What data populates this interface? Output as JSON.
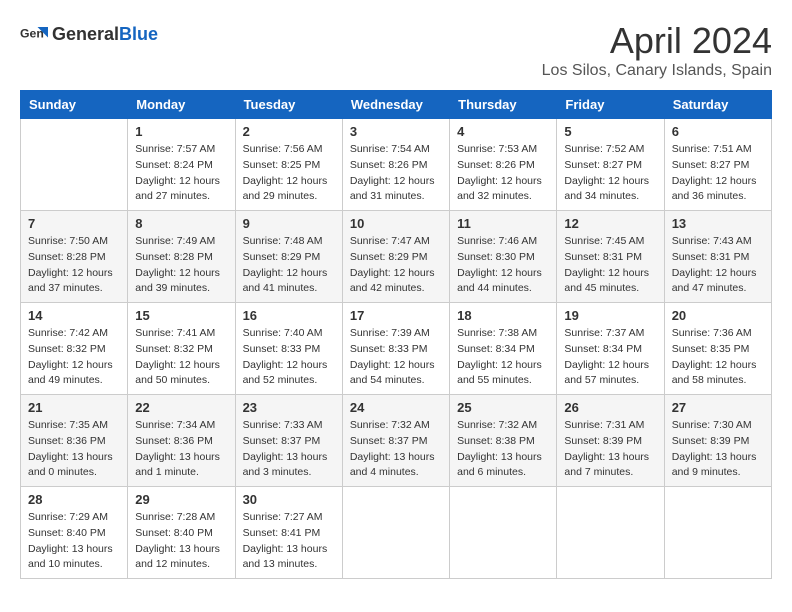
{
  "header": {
    "logo_general": "General",
    "logo_blue": "Blue",
    "month_year": "April 2024",
    "location": "Los Silos, Canary Islands, Spain"
  },
  "days_of_week": [
    "Sunday",
    "Monday",
    "Tuesday",
    "Wednesday",
    "Thursday",
    "Friday",
    "Saturday"
  ],
  "weeks": [
    [
      {
        "day": "",
        "sunrise": "",
        "sunset": "",
        "daylight": ""
      },
      {
        "day": "1",
        "sunrise": "Sunrise: 7:57 AM",
        "sunset": "Sunset: 8:24 PM",
        "daylight": "Daylight: 12 hours and 27 minutes."
      },
      {
        "day": "2",
        "sunrise": "Sunrise: 7:56 AM",
        "sunset": "Sunset: 8:25 PM",
        "daylight": "Daylight: 12 hours and 29 minutes."
      },
      {
        "day": "3",
        "sunrise": "Sunrise: 7:54 AM",
        "sunset": "Sunset: 8:26 PM",
        "daylight": "Daylight: 12 hours and 31 minutes."
      },
      {
        "day": "4",
        "sunrise": "Sunrise: 7:53 AM",
        "sunset": "Sunset: 8:26 PM",
        "daylight": "Daylight: 12 hours and 32 minutes."
      },
      {
        "day": "5",
        "sunrise": "Sunrise: 7:52 AM",
        "sunset": "Sunset: 8:27 PM",
        "daylight": "Daylight: 12 hours and 34 minutes."
      },
      {
        "day": "6",
        "sunrise": "Sunrise: 7:51 AM",
        "sunset": "Sunset: 8:27 PM",
        "daylight": "Daylight: 12 hours and 36 minutes."
      }
    ],
    [
      {
        "day": "7",
        "sunrise": "Sunrise: 7:50 AM",
        "sunset": "Sunset: 8:28 PM",
        "daylight": "Daylight: 12 hours and 37 minutes."
      },
      {
        "day": "8",
        "sunrise": "Sunrise: 7:49 AM",
        "sunset": "Sunset: 8:28 PM",
        "daylight": "Daylight: 12 hours and 39 minutes."
      },
      {
        "day": "9",
        "sunrise": "Sunrise: 7:48 AM",
        "sunset": "Sunset: 8:29 PM",
        "daylight": "Daylight: 12 hours and 41 minutes."
      },
      {
        "day": "10",
        "sunrise": "Sunrise: 7:47 AM",
        "sunset": "Sunset: 8:29 PM",
        "daylight": "Daylight: 12 hours and 42 minutes."
      },
      {
        "day": "11",
        "sunrise": "Sunrise: 7:46 AM",
        "sunset": "Sunset: 8:30 PM",
        "daylight": "Daylight: 12 hours and 44 minutes."
      },
      {
        "day": "12",
        "sunrise": "Sunrise: 7:45 AM",
        "sunset": "Sunset: 8:31 PM",
        "daylight": "Daylight: 12 hours and 45 minutes."
      },
      {
        "day": "13",
        "sunrise": "Sunrise: 7:43 AM",
        "sunset": "Sunset: 8:31 PM",
        "daylight": "Daylight: 12 hours and 47 minutes."
      }
    ],
    [
      {
        "day": "14",
        "sunrise": "Sunrise: 7:42 AM",
        "sunset": "Sunset: 8:32 PM",
        "daylight": "Daylight: 12 hours and 49 minutes."
      },
      {
        "day": "15",
        "sunrise": "Sunrise: 7:41 AM",
        "sunset": "Sunset: 8:32 PM",
        "daylight": "Daylight: 12 hours and 50 minutes."
      },
      {
        "day": "16",
        "sunrise": "Sunrise: 7:40 AM",
        "sunset": "Sunset: 8:33 PM",
        "daylight": "Daylight: 12 hours and 52 minutes."
      },
      {
        "day": "17",
        "sunrise": "Sunrise: 7:39 AM",
        "sunset": "Sunset: 8:33 PM",
        "daylight": "Daylight: 12 hours and 54 minutes."
      },
      {
        "day": "18",
        "sunrise": "Sunrise: 7:38 AM",
        "sunset": "Sunset: 8:34 PM",
        "daylight": "Daylight: 12 hours and 55 minutes."
      },
      {
        "day": "19",
        "sunrise": "Sunrise: 7:37 AM",
        "sunset": "Sunset: 8:34 PM",
        "daylight": "Daylight: 12 hours and 57 minutes."
      },
      {
        "day": "20",
        "sunrise": "Sunrise: 7:36 AM",
        "sunset": "Sunset: 8:35 PM",
        "daylight": "Daylight: 12 hours and 58 minutes."
      }
    ],
    [
      {
        "day": "21",
        "sunrise": "Sunrise: 7:35 AM",
        "sunset": "Sunset: 8:36 PM",
        "daylight": "Daylight: 13 hours and 0 minutes."
      },
      {
        "day": "22",
        "sunrise": "Sunrise: 7:34 AM",
        "sunset": "Sunset: 8:36 PM",
        "daylight": "Daylight: 13 hours and 1 minute."
      },
      {
        "day": "23",
        "sunrise": "Sunrise: 7:33 AM",
        "sunset": "Sunset: 8:37 PM",
        "daylight": "Daylight: 13 hours and 3 minutes."
      },
      {
        "day": "24",
        "sunrise": "Sunrise: 7:32 AM",
        "sunset": "Sunset: 8:37 PM",
        "daylight": "Daylight: 13 hours and 4 minutes."
      },
      {
        "day": "25",
        "sunrise": "Sunrise: 7:32 AM",
        "sunset": "Sunset: 8:38 PM",
        "daylight": "Daylight: 13 hours and 6 minutes."
      },
      {
        "day": "26",
        "sunrise": "Sunrise: 7:31 AM",
        "sunset": "Sunset: 8:39 PM",
        "daylight": "Daylight: 13 hours and 7 minutes."
      },
      {
        "day": "27",
        "sunrise": "Sunrise: 7:30 AM",
        "sunset": "Sunset: 8:39 PM",
        "daylight": "Daylight: 13 hours and 9 minutes."
      }
    ],
    [
      {
        "day": "28",
        "sunrise": "Sunrise: 7:29 AM",
        "sunset": "Sunset: 8:40 PM",
        "daylight": "Daylight: 13 hours and 10 minutes."
      },
      {
        "day": "29",
        "sunrise": "Sunrise: 7:28 AM",
        "sunset": "Sunset: 8:40 PM",
        "daylight": "Daylight: 13 hours and 12 minutes."
      },
      {
        "day": "30",
        "sunrise": "Sunrise: 7:27 AM",
        "sunset": "Sunset: 8:41 PM",
        "daylight": "Daylight: 13 hours and 13 minutes."
      },
      {
        "day": "",
        "sunrise": "",
        "sunset": "",
        "daylight": ""
      },
      {
        "day": "",
        "sunrise": "",
        "sunset": "",
        "daylight": ""
      },
      {
        "day": "",
        "sunrise": "",
        "sunset": "",
        "daylight": ""
      },
      {
        "day": "",
        "sunrise": "",
        "sunset": "",
        "daylight": ""
      }
    ]
  ]
}
